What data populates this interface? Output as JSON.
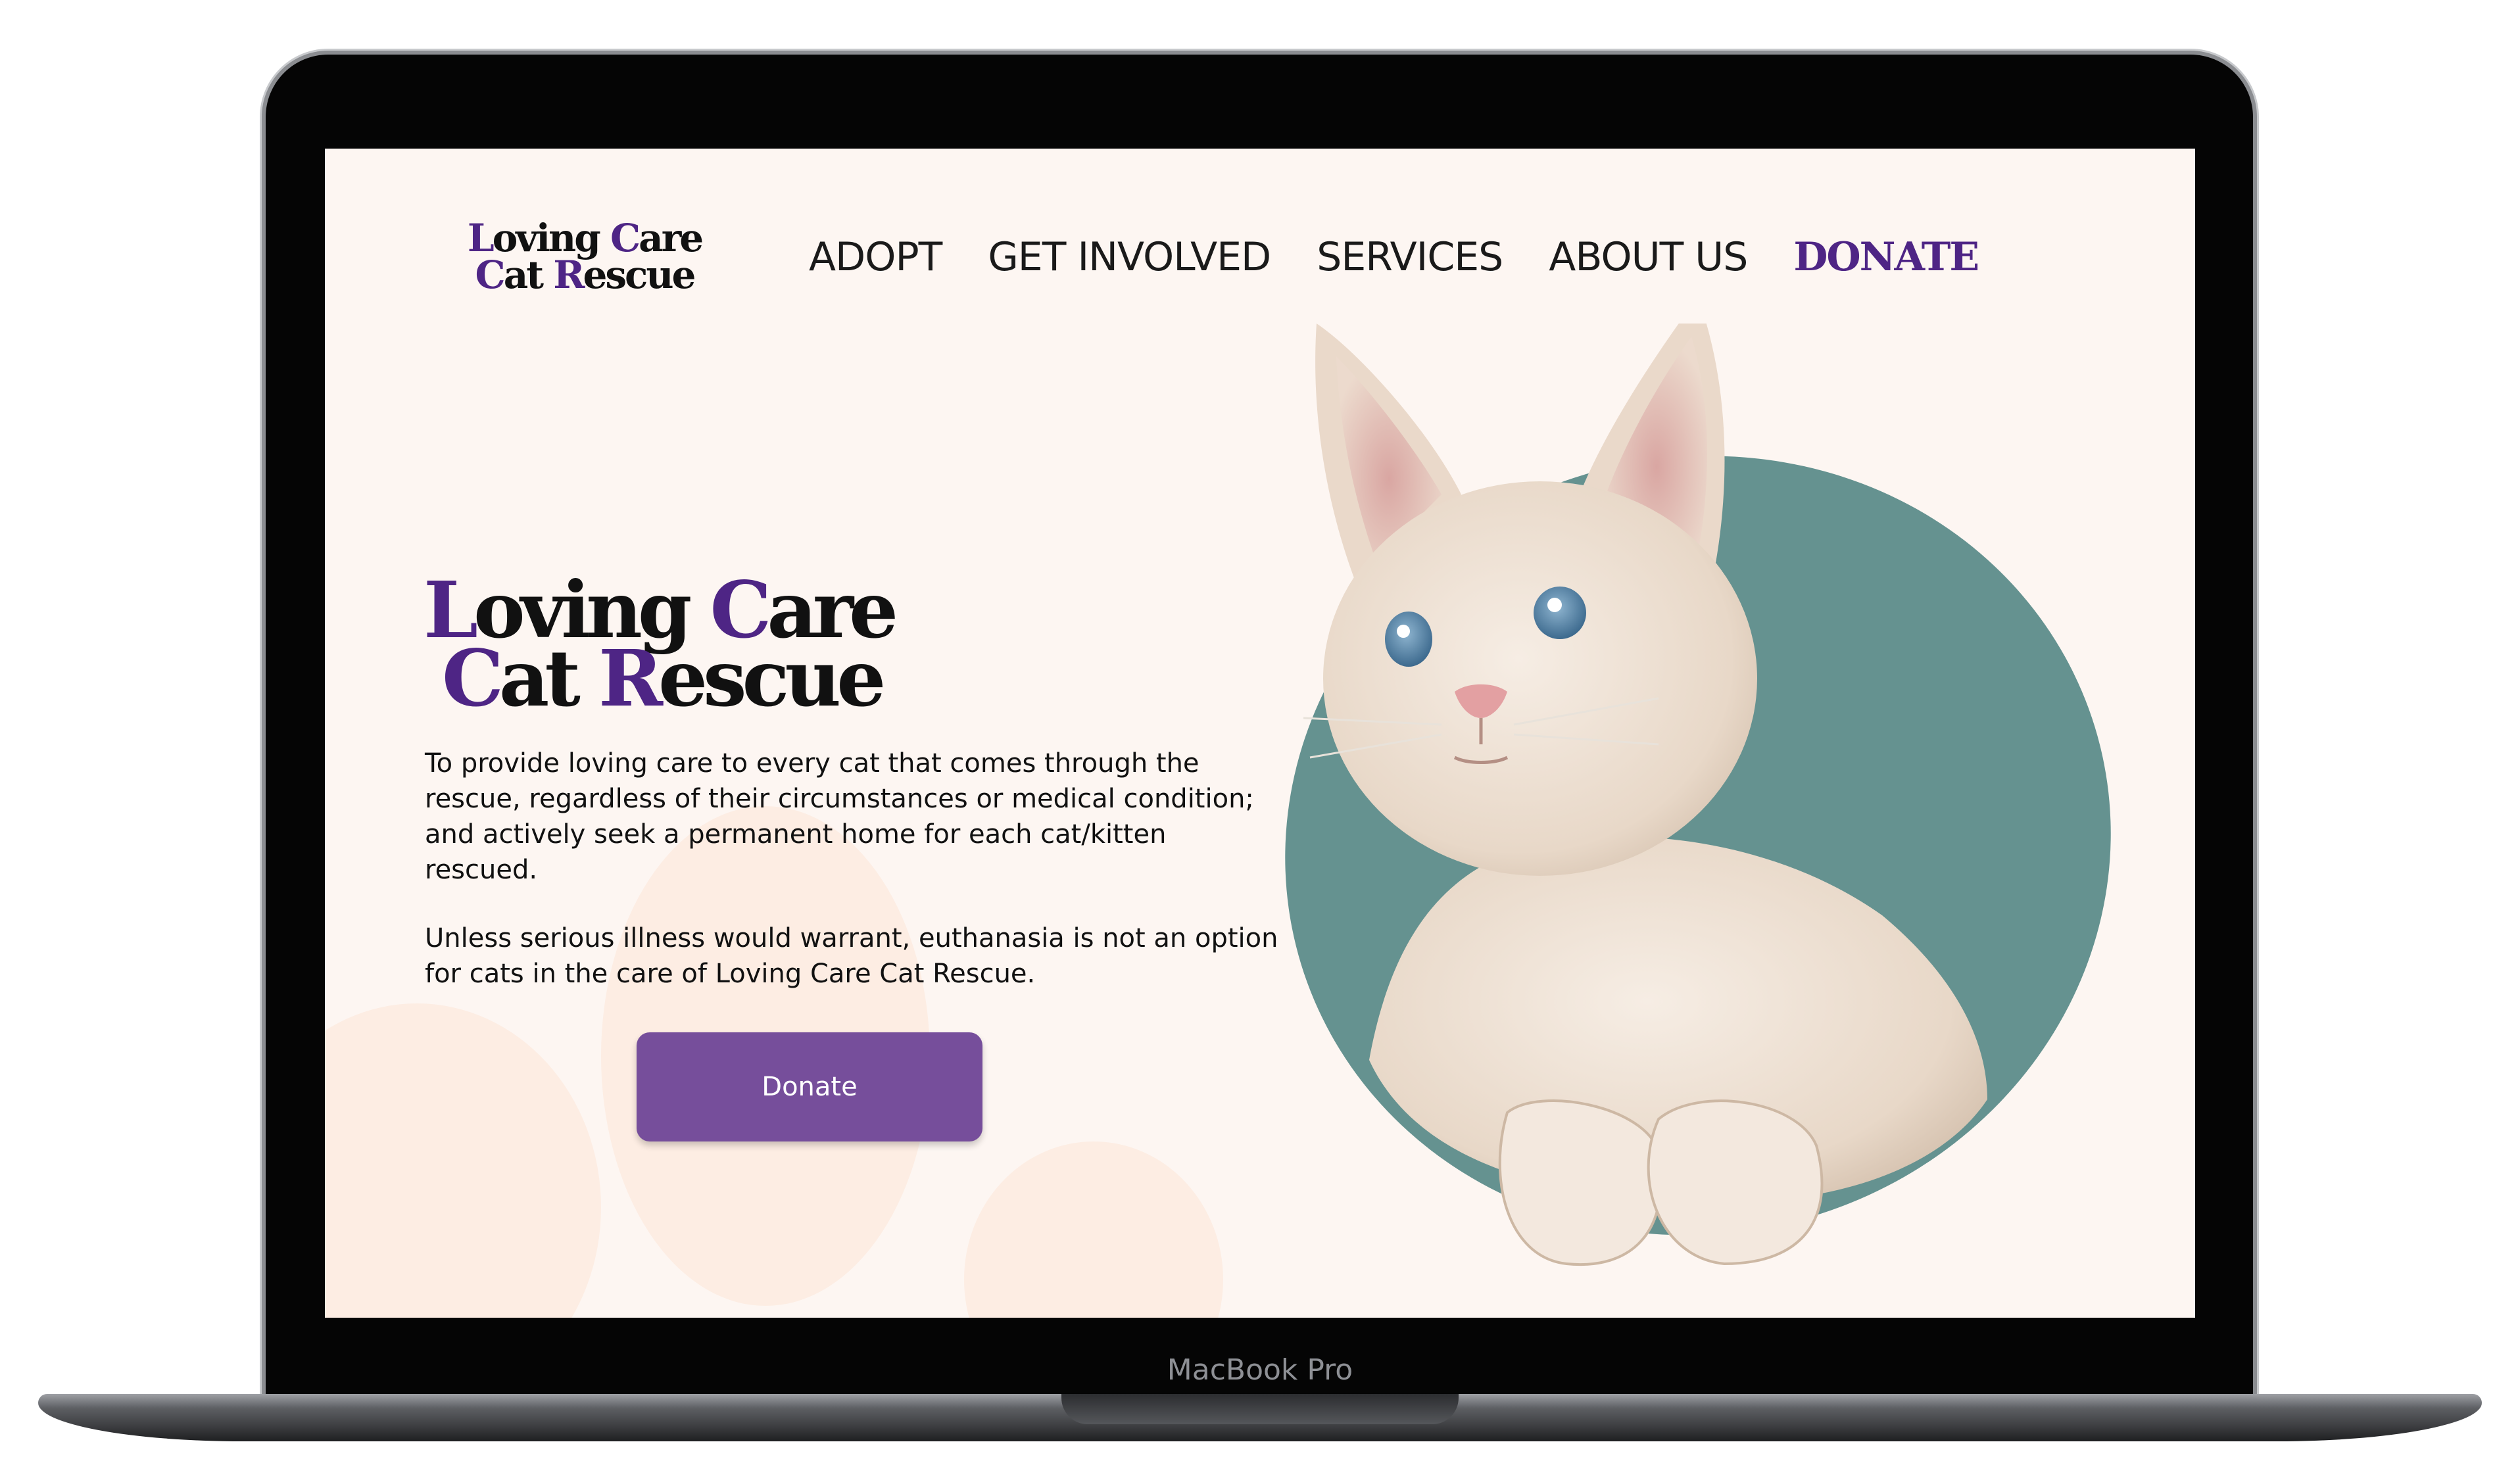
{
  "device": {
    "model_label": "MacBook Pro"
  },
  "site": {
    "logo": {
      "line1_accent": "L",
      "line1_mid": "oving ",
      "line1_accent2": "C",
      "line1_rest": "are",
      "line2_accent": "C",
      "line2_mid": "at ",
      "line2_accent2": "R",
      "line2_rest": "escue"
    },
    "nav": {
      "items": [
        "ADOPT",
        "GET INVOLVED",
        "SERVICES",
        "ABOUT US"
      ],
      "donate": "DONATE"
    },
    "hero": {
      "title_line1_accent": "L",
      "title_line1_mid": "oving ",
      "title_line1_accent2": "C",
      "title_line1_rest": "are",
      "title_line2_accent": "C",
      "title_line2_mid": "at ",
      "title_line2_accent2": "R",
      "title_line2_rest": "escue",
      "paragraph1": "To provide loving care to every cat that comes through the rescue, regardless of their circumstances or medical condition; and actively seek a permanent home for each cat/kitten rescued.",
      "paragraph2": "Unless serious illness would warrant, euthanasia is not an option for cats in the care of Loving Care Cat Rescue.",
      "button_label": "Donate"
    },
    "colors": {
      "accent": "#4e2585",
      "button": "#764e9b",
      "teal": "#659290",
      "background": "#fdf6f2"
    }
  }
}
